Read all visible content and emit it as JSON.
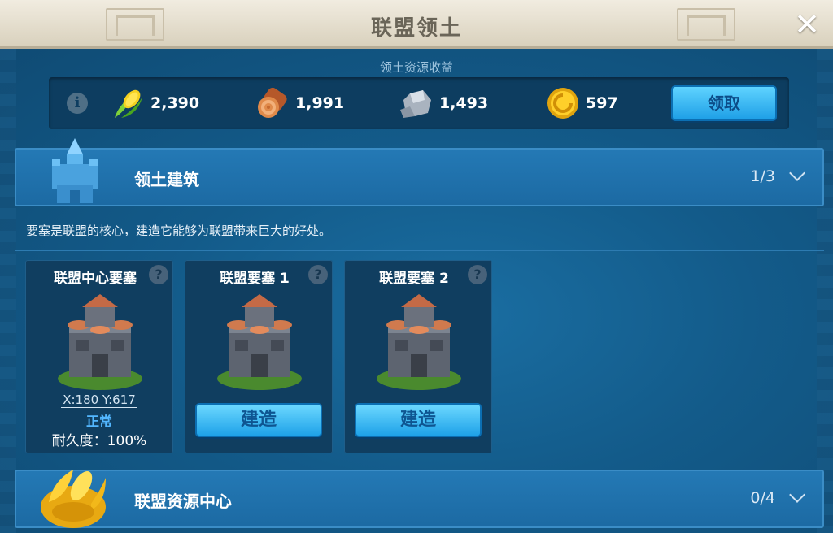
{
  "window": {
    "title": "联盟领土",
    "close_symbol": "✕"
  },
  "income": {
    "title": "领土资源收益",
    "info_symbol": "i",
    "resources": [
      {
        "name": "food",
        "icon": "corn-icon",
        "value": "2,390"
      },
      {
        "name": "wood",
        "icon": "wood-log-icon",
        "value": "1,991"
      },
      {
        "name": "stone",
        "icon": "stone-icon",
        "value": "1,493"
      },
      {
        "name": "gold",
        "icon": "gold-coin-icon",
        "value": "597"
      }
    ],
    "claim_label": "领取"
  },
  "sections": {
    "buildings": {
      "title": "领土建筑",
      "count": "1/3",
      "icon": "blue-fortress-icon",
      "description": "要塞是联盟的核心，建造它能够为联盟带来巨大的好处。",
      "cards": [
        {
          "title": "联盟中心要塞",
          "help": "?",
          "coords": "X:180 Y:617",
          "status": "正常",
          "durability": "耐久度：100%"
        },
        {
          "title": "联盟要塞 1",
          "help": "?",
          "build_label": "建造"
        },
        {
          "title": "联盟要塞 2",
          "help": "?",
          "build_label": "建造"
        }
      ]
    },
    "resource_centers": {
      "title": "联盟资源中心",
      "count": "0/4",
      "icon": "gold-corn-icon"
    }
  },
  "colors": {
    "title_bar": "#e6e0d0",
    "panel": "#155c8c",
    "button": "#1fa2e8",
    "status": "#53b7ff"
  }
}
